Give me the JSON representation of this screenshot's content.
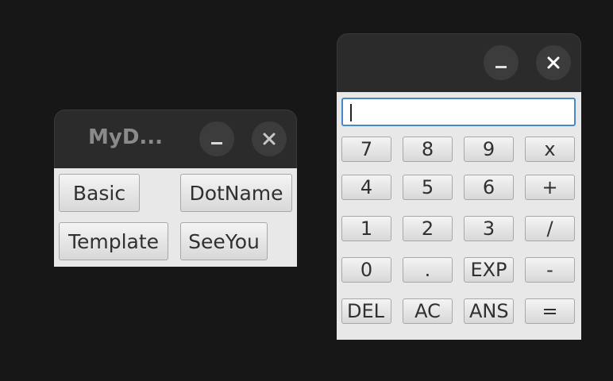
{
  "left_window": {
    "title": "MyD...",
    "buttons": {
      "basic": "Basic",
      "dotname": "DotName",
      "template": "Template",
      "seeyou": "SeeYou"
    }
  },
  "calc_window": {
    "display_value": "",
    "keys": {
      "k7": "7",
      "k8": "8",
      "k9": "9",
      "kx": "x",
      "k4": "4",
      "k5": "5",
      "k6": "6",
      "kplus": "+",
      "k1": "1",
      "k2": "2",
      "k3": "3",
      "kdiv": "/",
      "k0": "0",
      "kdot": ".",
      "kexp": "EXP",
      "kminus": "-",
      "kdel": "DEL",
      "kac": "AC",
      "kans": "ANS",
      "keq": "="
    }
  },
  "icons": {
    "minimize": "minimize-icon",
    "close": "close-icon"
  }
}
